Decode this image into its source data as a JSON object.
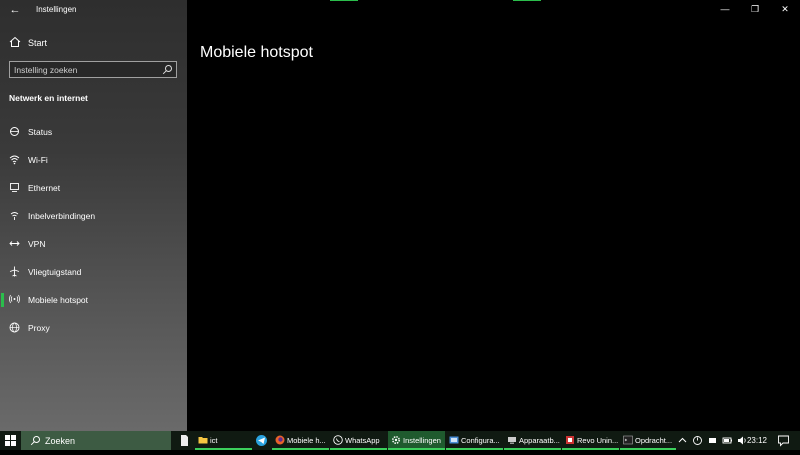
{
  "window": {
    "app_title": "Instellingen",
    "controls": {
      "minimize": "—",
      "maximize": "❐",
      "close": "✕"
    }
  },
  "sidebar": {
    "home_label": "Start",
    "search_placeholder": "Instelling zoeken",
    "section_title": "Netwerk en internet",
    "items": [
      {
        "label": "Status",
        "icon": "status-icon"
      },
      {
        "label": "Wi-Fi",
        "icon": "wifi-icon"
      },
      {
        "label": "Ethernet",
        "icon": "ethernet-icon"
      },
      {
        "label": "Inbelverbindingen",
        "icon": "dialup-icon"
      },
      {
        "label": "VPN",
        "icon": "vpn-icon"
      },
      {
        "label": "Vliegtuigstand",
        "icon": "airplane-icon"
      },
      {
        "label": "Mobiele hotspot",
        "icon": "hotspot-icon",
        "active": true
      },
      {
        "label": "Proxy",
        "icon": "proxy-icon"
      }
    ]
  },
  "main": {
    "page_title": "Mobiele hotspot"
  },
  "taskbar": {
    "search_label": "Zoeken",
    "apps": [
      {
        "label": "ict",
        "icon": "folder-icon"
      },
      {
        "label": "Mobiele h...",
        "icon": "firefox-icon"
      },
      {
        "label": "WhatsApp",
        "icon": "whatsapp-icon"
      },
      {
        "label": "Instellingen",
        "icon": "settings-gear-icon",
        "active": true
      },
      {
        "label": "Configura...",
        "icon": "config-icon"
      },
      {
        "label": "Apparaatb...",
        "icon": "device-manager-icon"
      },
      {
        "label": "Revo Unin...",
        "icon": "revo-icon"
      },
      {
        "label": "Opdracht...",
        "icon": "cmd-icon"
      }
    ],
    "clock": "23:12"
  },
  "colors": {
    "accent": "#2bbd4c",
    "taskbar": "#101a12",
    "active_task": "#1f5a2e"
  }
}
